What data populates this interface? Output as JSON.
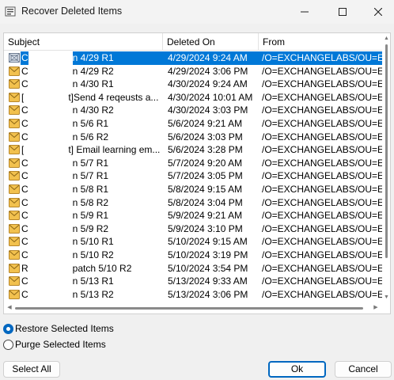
{
  "window": {
    "title": "Recover Deleted Items",
    "controls": {
      "minimize": "minimize-icon",
      "maximize": "maximize-icon",
      "close": "close-icon"
    }
  },
  "list": {
    "columns": {
      "subject": "Subject",
      "deleted_on": "Deleted On",
      "from": "From"
    },
    "selected_color": "#0078d7",
    "rows": [
      {
        "subject": "C",
        "subject_tail": "n 4/29  R1",
        "deleted_on": "4/29/2024 9:24 AM",
        "from": "/O=EXCHANGELABS/OU=EXCH",
        "selected": true,
        "icon": "recurring-item-icon"
      },
      {
        "subject": "C",
        "subject_tail": "n 4/29  R2",
        "deleted_on": "4/29/2024 3:06 PM",
        "from": "/O=EXCHANGELABS/OU=EXCH",
        "icon": "envelope-icon"
      },
      {
        "subject": "C",
        "subject_tail": "n 4/30  R1",
        "deleted_on": "4/30/2024 9:24 AM",
        "from": "/O=EXCHANGELABS/OU=EXCH",
        "icon": "envelope-icon"
      },
      {
        "subject": "[",
        "subject_tail": "t]Send 4 reqeusts a...",
        "deleted_on": "4/30/2024 10:01 AM",
        "from": "/O=EXCHANGELABS/OU=EXCH",
        "icon": "envelope-icon"
      },
      {
        "subject": "C",
        "subject_tail": "n 4/30  R2",
        "deleted_on": "4/30/2024 3:03 PM",
        "from": "/O=EXCHANGELABS/OU=EXCH",
        "icon": "envelope-icon"
      },
      {
        "subject": "C",
        "subject_tail": "n 5/6  R1",
        "deleted_on": "5/6/2024 9:21 AM",
        "from": "/O=EXCHANGELABS/OU=EXCH",
        "icon": "envelope-icon"
      },
      {
        "subject": "C",
        "subject_tail": "n 5/6  R2",
        "deleted_on": "5/6/2024 3:03 PM",
        "from": "/O=EXCHANGELABS/OU=EXCH",
        "icon": "envelope-icon"
      },
      {
        "subject": "[",
        "subject_tail": "t] Email learning em...",
        "deleted_on": "5/6/2024 3:28 PM",
        "from": "/O=EXCHANGELABS/OU=EXCH",
        "icon": "envelope-icon"
      },
      {
        "subject": "C",
        "subject_tail": "n 5/7  R1",
        "deleted_on": "5/7/2024 9:20 AM",
        "from": "/O=EXCHANGELABS/OU=EXCH",
        "icon": "envelope-icon"
      },
      {
        "subject": "C",
        "subject_tail": "n 5/7  R1",
        "deleted_on": "5/7/2024 3:05 PM",
        "from": "/O=EXCHANGELABS/OU=EXCH",
        "icon": "envelope-icon"
      },
      {
        "subject": "C",
        "subject_tail": "n 5/8  R1",
        "deleted_on": "5/8/2024 9:15 AM",
        "from": "/O=EXCHANGELABS/OU=EXCH",
        "icon": "envelope-icon"
      },
      {
        "subject": "C",
        "subject_tail": "n 5/8  R2",
        "deleted_on": "5/8/2024 3:04 PM",
        "from": "/O=EXCHANGELABS/OU=EXCH",
        "icon": "envelope-icon"
      },
      {
        "subject": "C",
        "subject_tail": "n 5/9  R1",
        "deleted_on": "5/9/2024 9:21 AM",
        "from": "/O=EXCHANGELABS/OU=EXCH",
        "icon": "envelope-icon"
      },
      {
        "subject": "C",
        "subject_tail": "n 5/9  R2",
        "deleted_on": "5/9/2024 3:10 PM",
        "from": "/O=EXCHANGELABS/OU=EXCH",
        "icon": "envelope-icon"
      },
      {
        "subject": "C",
        "subject_tail": "n 5/10  R1",
        "deleted_on": "5/10/2024 9:15 AM",
        "from": "/O=EXCHANGELABS/OU=EXCH",
        "icon": "envelope-icon"
      },
      {
        "subject": "C",
        "subject_tail": "n 5/10  R2",
        "deleted_on": "5/10/2024 3:19 PM",
        "from": "/O=EXCHANGELABS/OU=EXCH",
        "icon": "envelope-icon"
      },
      {
        "subject": "R",
        "subject_tail": "patch 5/10  R2",
        "deleted_on": "5/10/2024 3:54 PM",
        "from": "/O=EXCHANGELABS/OU=EXCH",
        "icon": "envelope-icon"
      },
      {
        "subject": "C",
        "subject_tail": "n 5/13  R1",
        "deleted_on": "5/13/2024 9:33 AM",
        "from": "/O=EXCHANGELABS/OU=EXCH",
        "icon": "envelope-icon"
      },
      {
        "subject": "C",
        "subject_tail": "n 5/13  R2",
        "deleted_on": "5/13/2024 3:06 PM",
        "from": "/O=EXCHANGELABS/OU=EXCH",
        "icon": "envelope-icon"
      }
    ]
  },
  "options": {
    "restore": {
      "label": "Restore Selected Items",
      "checked": true
    },
    "purge": {
      "label": "Purge Selected Items",
      "checked": false
    }
  },
  "buttons": {
    "select_all": "Select All",
    "ok": "Ok",
    "cancel": "Cancel"
  },
  "colors": {
    "accent": "#0067c0",
    "envelope": "#f2c14e"
  }
}
